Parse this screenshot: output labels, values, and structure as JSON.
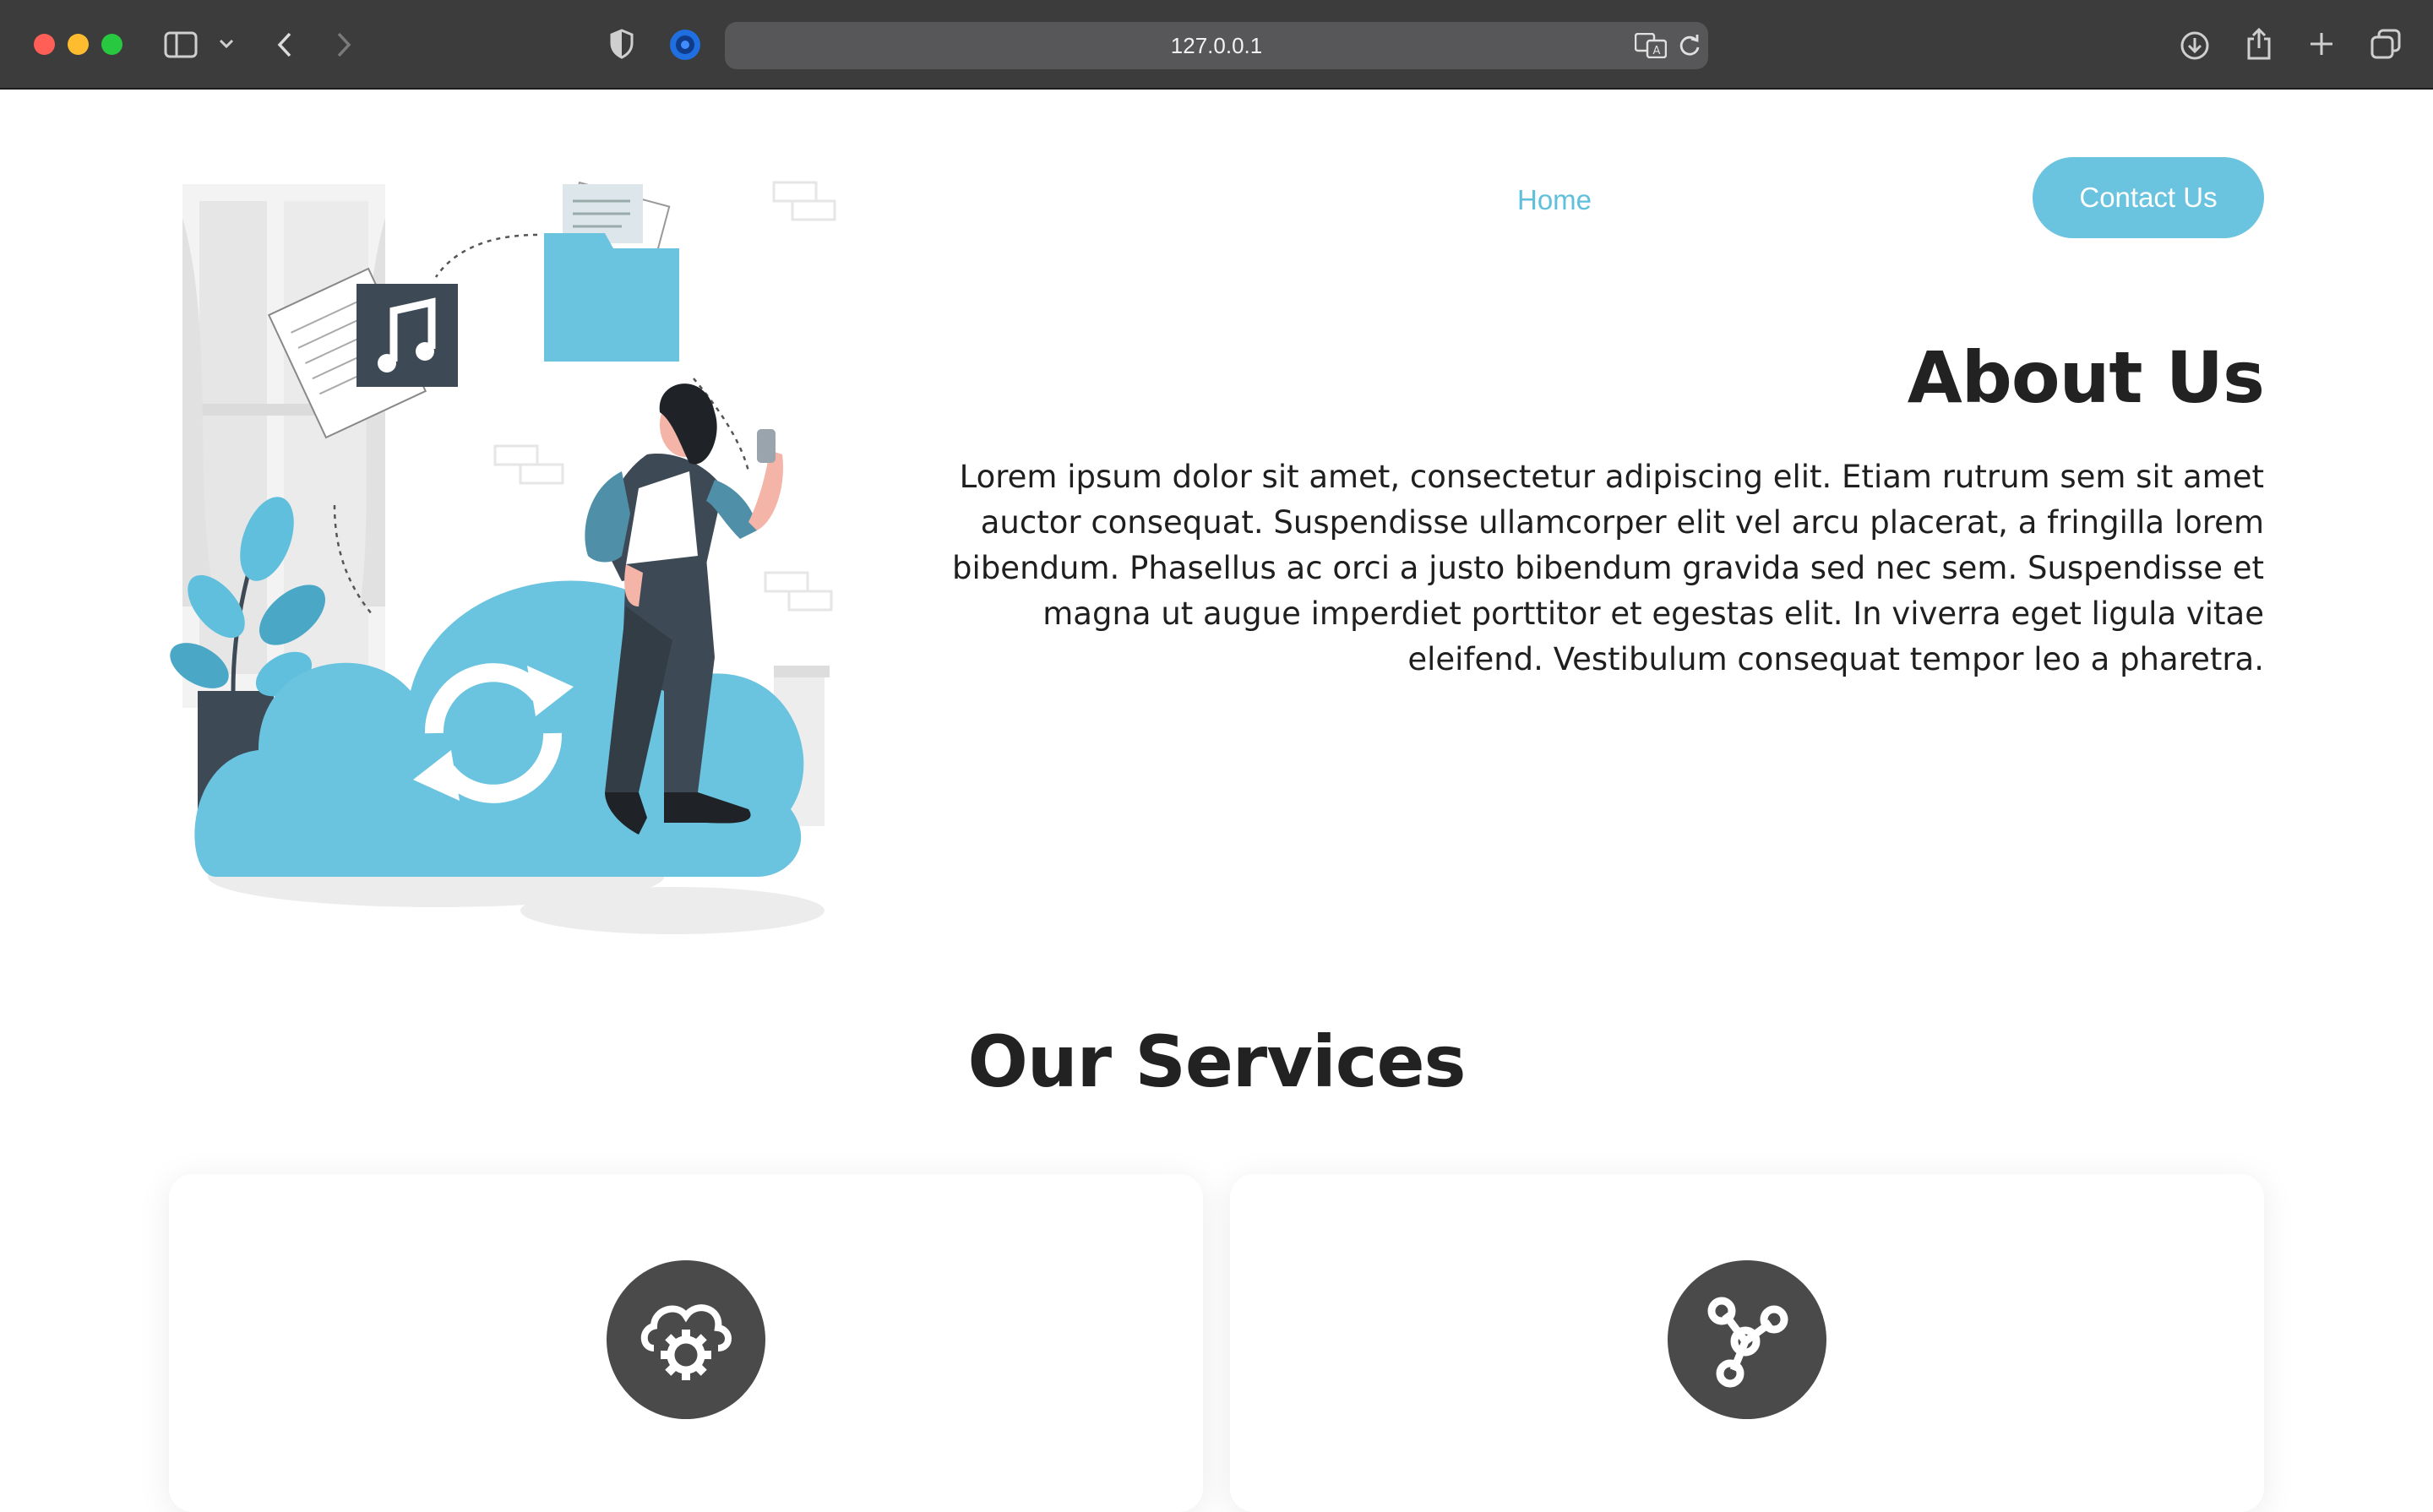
{
  "browser": {
    "url": "127.0.0.1",
    "icons": {
      "sidebar": "sidebar-icon",
      "back": "chevron-left-icon",
      "forward": "chevron-right-icon",
      "shield": "shield-icon",
      "extension": "extension-icon",
      "translate": "translate-icon",
      "reload": "reload-icon",
      "download": "download-icon",
      "share": "share-icon",
      "new_tab": "plus-icon",
      "tabs": "tabs-overview-icon"
    }
  },
  "nav": {
    "home_label": "Home",
    "contact_label": "Contact Us"
  },
  "about": {
    "title": "About Us",
    "body": "Lorem ipsum dolor sit amet, consectetur adipiscing elit. Etiam rutrum sem sit amet auctor consequat. Suspendisse ullamcorper elit vel arcu placerat, a fringilla lorem bibendum. Phasellus ac orci a justo bibendum gravida sed nec sem. Suspendisse et magna ut augue imperdiet porttitor et egestas elit. In viverra eget ligula vitae eleifend. Vestibulum consequat tempor leo a pharetra."
  },
  "services": {
    "title": "Our Services",
    "cards": [
      {
        "icon": "cloud-gear-icon"
      },
      {
        "icon": "network-nodes-icon"
      }
    ]
  },
  "colors": {
    "accent": "#6ac3df",
    "link": "#5fbfdc",
    "heading": "#222222",
    "icon_dark": "#4a4a4a"
  }
}
